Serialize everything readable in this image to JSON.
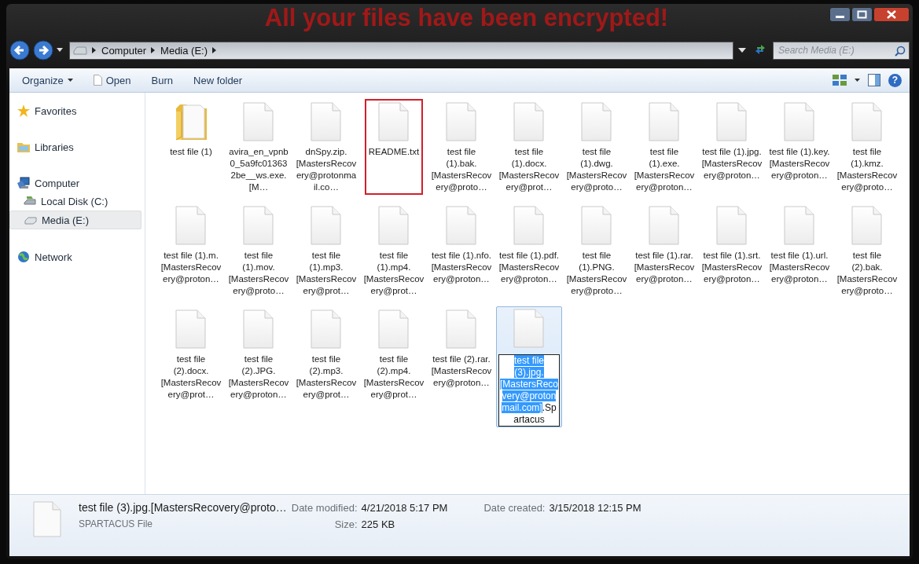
{
  "window": {
    "title": "All your files have been encrypted!"
  },
  "address": {
    "crumbs": [
      "Computer",
      "Media (E:)"
    ]
  },
  "search": {
    "placeholder": "Search Media (E:)"
  },
  "toolbar": {
    "buttons": [
      {
        "label": "Organize",
        "kind": "menu"
      },
      {
        "label": "Open",
        "kind": "open"
      },
      {
        "label": "Burn",
        "kind": "plain"
      },
      {
        "label": "New folder",
        "kind": "plain"
      }
    ],
    "help": "?"
  },
  "sidebar": {
    "items": [
      {
        "label": "Favorites",
        "kind": "favorites",
        "selected": false
      },
      {
        "label": "Libraries",
        "kind": "libraries",
        "selected": false
      },
      {
        "label": "Computer",
        "kind": "computer",
        "selected": false,
        "children": [
          {
            "label": "Local Disk (C:)",
            "kind": "disk",
            "selected": false
          },
          {
            "label": "Media (E:)",
            "kind": "drive",
            "selected": true
          }
        ]
      },
      {
        "label": "Network",
        "kind": "network",
        "selected": false
      }
    ]
  },
  "files": [
    {
      "label": "test file (1)",
      "kind": "folder",
      "selected": false,
      "outlined": false
    },
    {
      "label": "avira_en_vpnb0_5a9fc013632be__ws.exe.[M…",
      "kind": "file",
      "selected": false,
      "outlined": false
    },
    {
      "label": "dnSpy.zip.[MastersRecovery@protonmail.co…",
      "kind": "file",
      "selected": false,
      "outlined": false
    },
    {
      "label": "README.txt",
      "kind": "file",
      "selected": false,
      "outlined": true
    },
    {
      "label": "test file (1).bak.[MastersRecovery@proto…",
      "kind": "file",
      "selected": false,
      "outlined": false
    },
    {
      "label": "test file (1).docx.[MastersRecovery@prot…",
      "kind": "file",
      "selected": false,
      "outlined": false
    },
    {
      "label": "test file (1).dwg.[MastersRecovery@proto…",
      "kind": "file",
      "selected": false,
      "outlined": false
    },
    {
      "label": "test file (1).exe.[MastersRecovery@proton…",
      "kind": "file",
      "selected": false,
      "outlined": false
    },
    {
      "label": "test file (1).jpg.[MastersRecovery@proton…",
      "kind": "file",
      "selected": false,
      "outlined": false
    },
    {
      "label": "test file (1).key.[MastersRecovery@proton…",
      "kind": "file",
      "selected": false,
      "outlined": false
    },
    {
      "label": "test file (1).kmz.[MastersRecovery@proto…",
      "kind": "file",
      "selected": false,
      "outlined": false
    },
    {
      "label": "test file (1).m.[MastersRecovery@proton…",
      "kind": "file",
      "selected": false,
      "outlined": false
    },
    {
      "label": "test file (1).mov.[MastersRecovery@proto…",
      "kind": "file",
      "selected": false,
      "outlined": false
    },
    {
      "label": "test file (1).mp3.[MastersRecovery@prot…",
      "kind": "file",
      "selected": false,
      "outlined": false
    },
    {
      "label": "test file (1).mp4.[MastersRecovery@prot…",
      "kind": "file",
      "selected": false,
      "outlined": false
    },
    {
      "label": "test file (1).nfo.[MastersRecovery@proton…",
      "kind": "file",
      "selected": false,
      "outlined": false
    },
    {
      "label": "test file (1).pdf.[MastersRecovery@proton…",
      "kind": "file",
      "selected": false,
      "outlined": false
    },
    {
      "label": "test file (1).PNG.[MastersRecovery@proto…",
      "kind": "file",
      "selected": false,
      "outlined": false
    },
    {
      "label": "test file (1).rar.[MastersRecovery@proton…",
      "kind": "file",
      "selected": false,
      "outlined": false
    },
    {
      "label": "test file (1).srt.[MastersRecovery@proton…",
      "kind": "file",
      "selected": false,
      "outlined": false
    },
    {
      "label": "test file (1).url.[MastersRecovery@proton…",
      "kind": "file",
      "selected": false,
      "outlined": false
    },
    {
      "label": "test file (2).bak.[MastersRecovery@proto…",
      "kind": "file",
      "selected": false,
      "outlined": false
    },
    {
      "label": "test file (2).docx.[MastersRecovery@prot…",
      "kind": "file",
      "selected": false,
      "outlined": false
    },
    {
      "label": "test file (2).JPG.[MastersRecovery@proton…",
      "kind": "file",
      "selected": false,
      "outlined": false
    },
    {
      "label": "test file (2).mp3.[MastersRecovery@prot…",
      "kind": "file",
      "selected": false,
      "outlined": false
    },
    {
      "label": "test file (2).mp4.[MastersRecovery@prot…",
      "kind": "file",
      "selected": false,
      "outlined": false
    },
    {
      "label": "test file (2).rar.[MastersRecovery@proton…",
      "kind": "file",
      "selected": false,
      "outlined": false
    },
    {
      "label": "test file (3).jpg.[MastersRecovery@protonmail.com]",
      "extension": ".Spartacus",
      "kind": "file",
      "selected": true,
      "outlined": false
    }
  ],
  "details": {
    "name": "test file (3).jpg.[MastersRecovery@proto…",
    "type": "SPARTACUS File",
    "field_groups": [
      [
        {
          "label": "Date modified:",
          "value": "4/21/2018 5:17 PM"
        },
        {
          "label": "Size:",
          "value": "225 KB"
        }
      ],
      [
        {
          "label": "Date created:",
          "value": "3/15/2018 12:15 PM"
        }
      ]
    ]
  }
}
